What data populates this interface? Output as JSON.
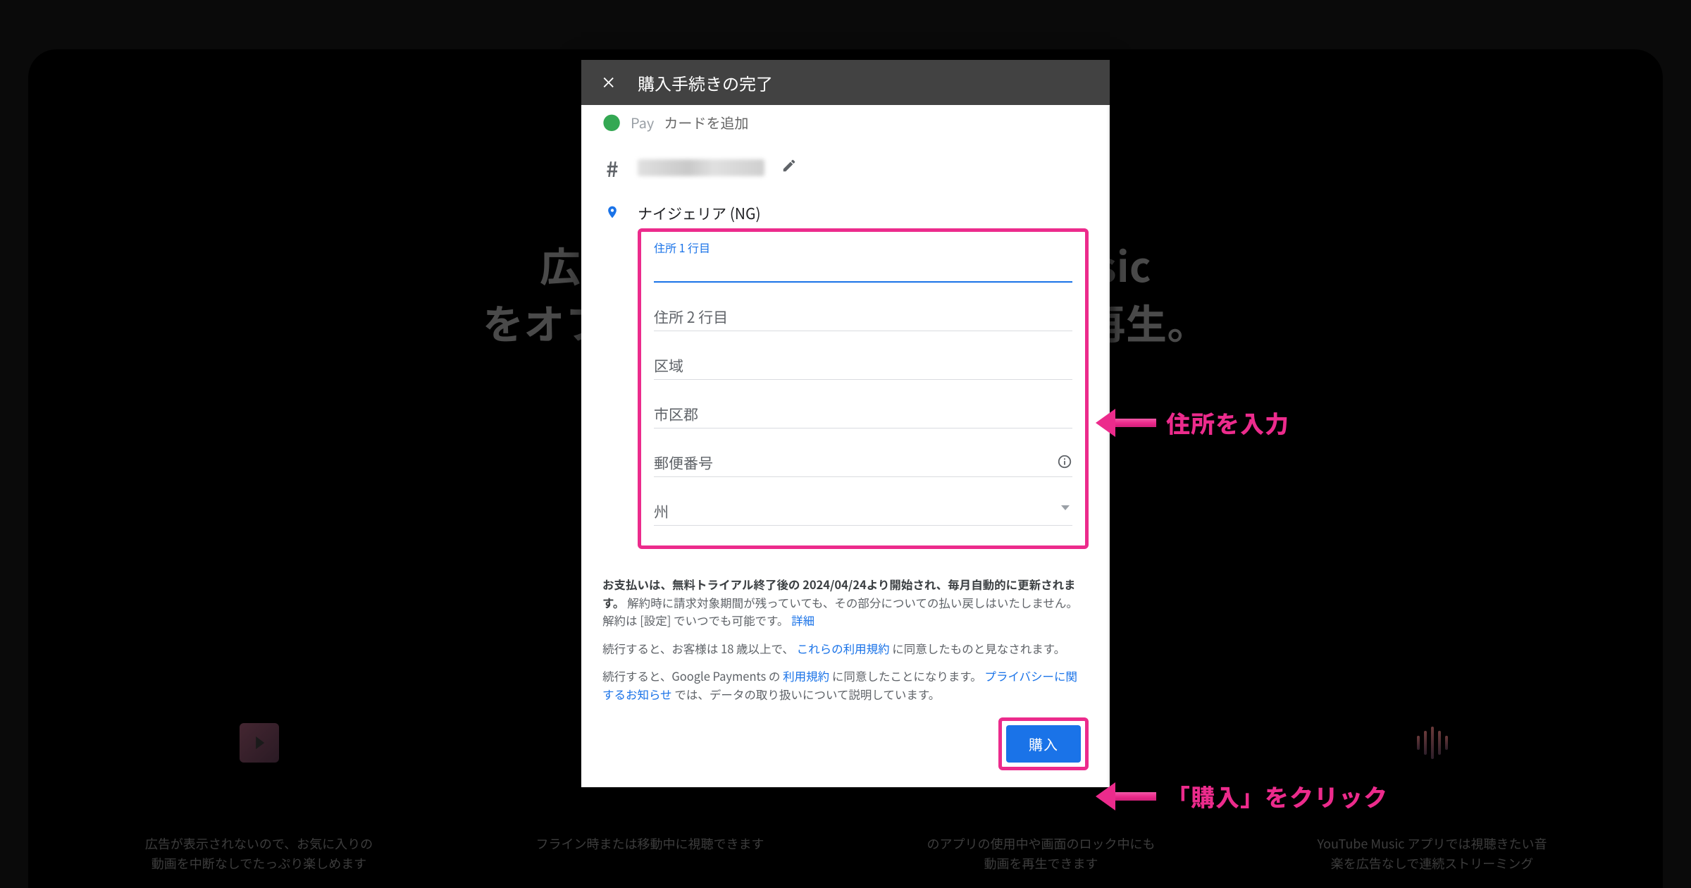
{
  "background": {
    "headline_line1": "広告なし",
    "headline_line2_left": "をオフライン",
    "headline_line2_right_1": "be Music",
    "headline_line2_right_2": "ンドで再生。",
    "features": [
      "広告が表示されないので、お気に入りの動画を中断なしでたっぷり楽しめます",
      "フライン時または移動中に視聴できます",
      "のアプリの使用中や画面のロック中にも動画を再生できます",
      "YouTube Music アプリでは視聴きたい音楽を広告なしで連続ストリーミング"
    ]
  },
  "modal": {
    "title": "購入手続きの完了",
    "pay_line_fragment": "カードを追加",
    "country": "ナイジェリア (NG)",
    "fields": {
      "address1": "住所 1 行目",
      "address2": "住所 2 行目",
      "district": "区域",
      "city": "市区郡",
      "postal": "郵便番号",
      "state": "州"
    },
    "legal1_pre": "お支払いは、無料トライアル終了後の 2024/04/24より開始され、毎月自動的に更新されます。",
    "legal1_post": "解約時に請求対象期間が残っていても、その部分についての払い戻しはいたしません。解約は [設定] でいつでも可能です。",
    "legal1_link": "詳細",
    "legal2_pre": "続行すると、お客様は 18 歳以上で、",
    "legal2_link": "これらの利用規約",
    "legal2_post": "に同意したものと見なされます。",
    "legal3_pre": "続行すると、Google Payments の",
    "legal3_link1": "利用規約",
    "legal3_mid": "に同意したことになります。",
    "legal3_link2": "プライバシーに関するお知らせ",
    "legal3_post": "では、データの取り扱いについて説明しています。",
    "buy": "購入"
  },
  "annotations": {
    "address": "住所を入力",
    "buy": "「購入」をクリック"
  }
}
